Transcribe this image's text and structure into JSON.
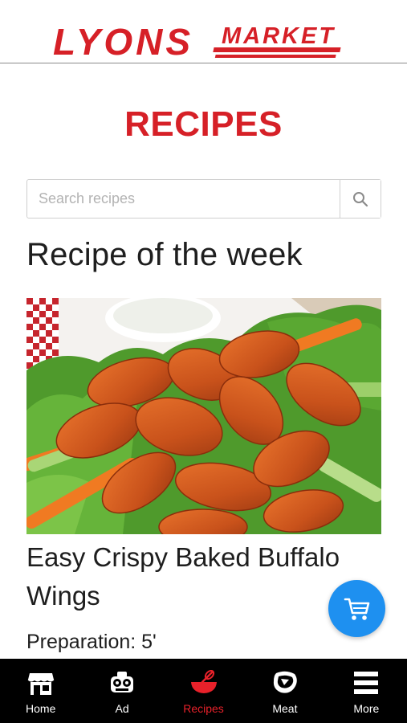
{
  "header": {
    "logo_main": "LYONS",
    "logo_sub": "MARKET",
    "brand_color": "#d62027"
  },
  "page": {
    "title": "RECIPES"
  },
  "search": {
    "placeholder": "Search recipes",
    "value": "",
    "icon": "search-icon"
  },
  "featured": {
    "section_title": "Recipe of the week",
    "recipe_title": "Easy Crispy Baked Buffalo Wings",
    "prep_label": "Preparation: 5'"
  },
  "cart": {
    "icon": "cart-icon",
    "color": "#1e90f0"
  },
  "bottom_nav": {
    "items": [
      {
        "label": "Home",
        "icon": "store-icon",
        "active": false
      },
      {
        "label": "Ad",
        "icon": "ad-icon",
        "active": false
      },
      {
        "label": "Recipes",
        "icon": "bowl-whisk-icon",
        "active": true
      },
      {
        "label": "Meat",
        "icon": "steak-icon",
        "active": false
      },
      {
        "label": "More",
        "icon": "menu-icon",
        "active": false
      }
    ],
    "active_color": "#e8212a"
  }
}
